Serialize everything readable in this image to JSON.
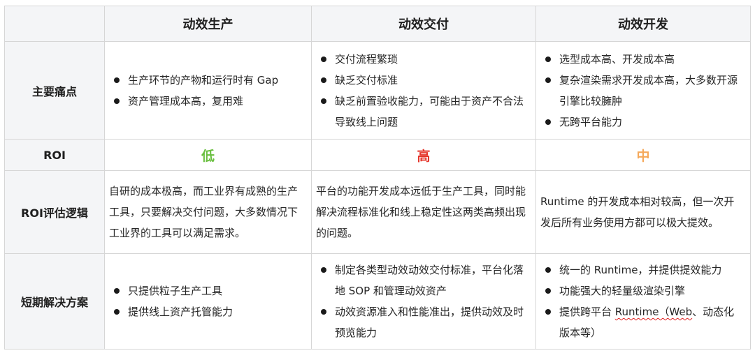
{
  "headers": [
    "",
    "动效生产",
    "动效交付",
    "动效开发"
  ],
  "rows": {
    "pain": {
      "label": "主要痛点",
      "cells": [
        [
          "生产环节的产物和运行时有 Gap",
          "资产管理成本高，复用难"
        ],
        [
          "交付流程繁琐",
          "缺乏交付标准",
          "缺乏前置验收能力，可能由于资产不合法导致线上问题"
        ],
        [
          "选型成本高、开发成本高",
          "复杂渲染需求开发成本高，大多数开源引擎比较臃肿",
          "无跨平台能力"
        ]
      ]
    },
    "roi": {
      "label": "ROI",
      "values": [
        "低",
        "高",
        "中"
      ],
      "colors": [
        "#6abf40",
        "#e5352b",
        "#f5a95b"
      ]
    },
    "logic": {
      "label": "ROI评估逻辑",
      "cells": [
        "自研的成本极高，而工业界有成熟的生产工具，只要解决交付问题，大多数情况下工业界的工具可以满足需求。",
        "平台的功能开发成本远低于生产工具，同时能解决流程标准化和线上稳定性这两类高频出现的问题。",
        "Runtime 的开发成本相对较高，但一次开发后所有业务使用方都可以极大提效。"
      ]
    },
    "plan": {
      "label": "短期解决方案",
      "cells": [
        [
          "只提供粒子生产工具",
          "提供线上资产托管能力"
        ],
        [
          "制定各类型动效动效交付标准，平台化落地 SOP 和管理动效资产",
          "动效资源准入和性能准出，提供动效及时预览能力"
        ],
        [
          "统一的 Runtime，并提供提效能力",
          "功能强大的轻量级渲染引擎"
        ]
      ],
      "last_item": {
        "prefix": "提供跨平台 ",
        "underlined": "Runtime（Web",
        "suffix": "、动态化版本等）"
      }
    }
  }
}
